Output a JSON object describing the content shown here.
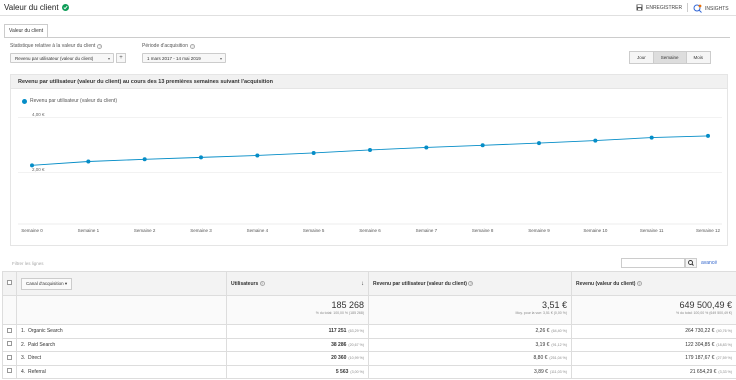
{
  "header": {
    "title": "Valeur du client",
    "save_label": "ENREGISTRER",
    "insights_label": "INSIGHTS"
  },
  "tab": {
    "label": "Valeur du client"
  },
  "controls": {
    "stat_label": "Statistique relative à la valeur du client",
    "stat_value": "Revenu par utilisateur (valeur du client)",
    "period_label": "Période d'acquisition",
    "period_value": "1 mars 2017 - 14 mai 2019",
    "granularity": [
      "Jour",
      "Semaine",
      "Mois"
    ],
    "granularity_active": "Semaine"
  },
  "chart_data": {
    "type": "line",
    "title": "Revenu par utilisateur (valeur du client) au cours des 13 premières semaines suivant l'acquisition",
    "series": [
      {
        "name": "Revenu par utilisateur (valeur du client)",
        "values": [
          2.26,
          2.4,
          2.48,
          2.55,
          2.62,
          2.71,
          2.82,
          2.91,
          2.99,
          3.07,
          3.16,
          3.27,
          3.33
        ]
      }
    ],
    "categories": [
      "Semaine 0",
      "Semaine 1",
      "Semaine 2",
      "Semaine 3",
      "Semaine 4",
      "Semaine 5",
      "Semaine 6",
      "Semaine 7",
      "Semaine 8",
      "Semaine 9",
      "Semaine 10",
      "Semaine 11",
      "Semaine 12"
    ],
    "y_ticks": [
      "4,00 €",
      "2,00 €"
    ],
    "y_tick_values": [
      4,
      2
    ],
    "legend": "top-left",
    "color": "#058dc7"
  },
  "table": {
    "filter_placeholder": "Filtrer les lignes",
    "advanced_label": "avancé",
    "columns": [
      "Canal d'acquisition",
      "Utilisateurs",
      "Revenu par utilisateur (valeur du client)",
      "Revenu (valeur du client)"
    ],
    "totals": {
      "users": "185 268",
      "users_sub": "% du total: 100,00 % (185 268)",
      "rpu": "3,51 €",
      "rpu_sub": "Moy. pour la vue: 3,51 € (0,00 %)",
      "revenue": "649 500,49 €",
      "revenue_sub": "% du total: 100,00 % (649 500,49 €)"
    },
    "rows": [
      {
        "index": "1.",
        "channel": "Organic Search",
        "users": "117 251",
        "users_pct": "(63,29 %)",
        "rpu": "2,26 €",
        "rpu_pct": "(64,40 %)",
        "revenue": "264 730,22 €",
        "revenue_pct": "(40,76 %)"
      },
      {
        "index": "2.",
        "channel": "Paid Search",
        "users": "38 286",
        "users_pct": "(20,67 %)",
        "rpu": "3,19 €",
        "rpu_pct": "(91,12 %)",
        "revenue": "122 304,85 €",
        "revenue_pct": "(18,83 %)"
      },
      {
        "index": "3.",
        "channel": "Direct",
        "users": "20 360",
        "users_pct": "(10,99 %)",
        "rpu": "8,80 €",
        "rpu_pct": "(251,04 %)",
        "revenue": "179 187,67 €",
        "revenue_pct": "(27,59 %)"
      },
      {
        "index": "4.",
        "channel": "Referral",
        "users": "5 563",
        "users_pct": "(3,00 %)",
        "rpu": "3,89 €",
        "rpu_pct": "(111,03 %)",
        "revenue": "21 654,29 €",
        "revenue_pct": "(3,33 %)"
      }
    ]
  }
}
